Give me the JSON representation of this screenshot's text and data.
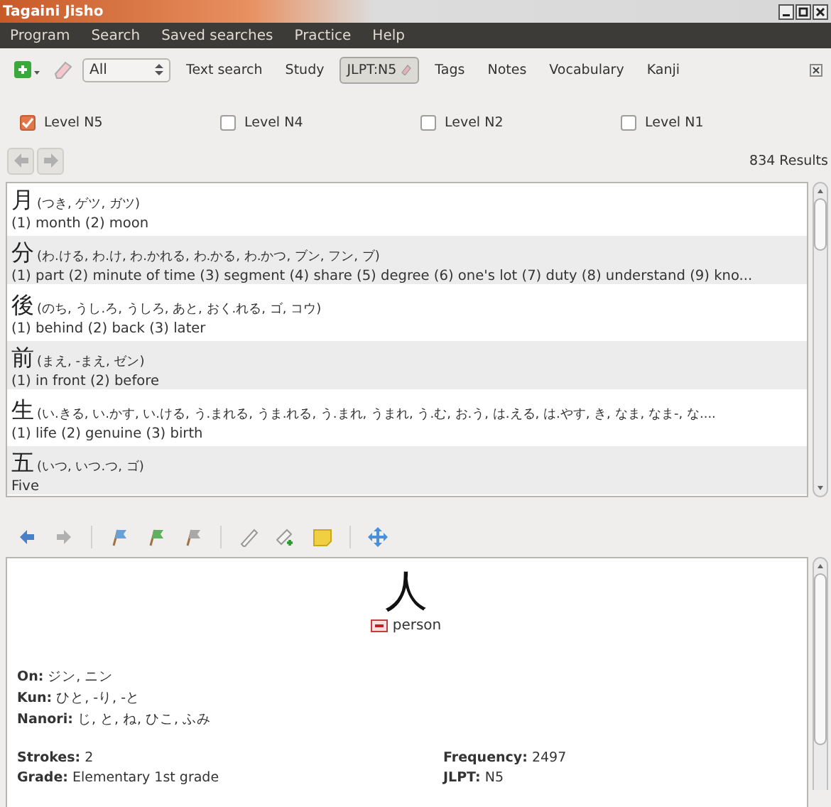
{
  "window": {
    "title": "Tagaini Jisho"
  },
  "menu": [
    "Program",
    "Search",
    "Saved searches",
    "Practice",
    "Help"
  ],
  "toolbar": {
    "filter": "All",
    "tabs": [
      {
        "label": "Text search",
        "selected": false,
        "removable": false
      },
      {
        "label": "Study",
        "selected": false,
        "removable": false
      },
      {
        "label": "JLPT:N5",
        "selected": true,
        "removable": true
      },
      {
        "label": "Tags",
        "selected": false,
        "removable": false
      },
      {
        "label": "Notes",
        "selected": false,
        "removable": false
      },
      {
        "label": "Vocabulary",
        "selected": false,
        "removable": false
      },
      {
        "label": "Kanji",
        "selected": false,
        "removable": false
      }
    ]
  },
  "levels": [
    {
      "label": "Level N5",
      "checked": true
    },
    {
      "label": "Level N4",
      "checked": false
    },
    {
      "label": "Level N2",
      "checked": false
    },
    {
      "label": "Level N1",
      "checked": false
    }
  ],
  "results": "834 Results",
  "entries": [
    {
      "kanji": "月",
      "readings": "(つき, ゲツ, ガツ)",
      "meaning": "(1) month (2) moon"
    },
    {
      "kanji": "分",
      "readings": "(わ.ける, わ.け, わ.かれる, わ.かる, わ.かつ, ブン, フン, ブ)",
      "meaning": "(1) part (2) minute of time (3) segment (4) share (5) degree (6) one's lot (7) duty (8) understand (9) kno..."
    },
    {
      "kanji": "後",
      "readings": "(のち, うし.ろ, うしろ, あと, おく.れる, ゴ, コウ)",
      "meaning": "(1) behind (2) back (3) later"
    },
    {
      "kanji": "前",
      "readings": "(まえ, -まえ, ゼン)",
      "meaning": "(1) in front (2) before"
    },
    {
      "kanji": "生",
      "readings": "(い.きる, い.かす, い.ける, う.まれる, うま.れる, う.まれ, うまれ, う.む, お.う, は.える, は.やす, き, なま, なま-, な....",
      "meaning": "(1) life (2) genuine (3) birth"
    },
    {
      "kanji": "五",
      "readings": "(いつ, いつ.つ, ゴ)",
      "meaning": "Five"
    }
  ],
  "detail": {
    "kanji": "人",
    "meaning": "person",
    "readings": [
      {
        "label": "On:",
        "value": "ジン, ニン"
      },
      {
        "label": "Kun:",
        "value": "ひと, -り, -と"
      },
      {
        "label": "Nanori:",
        "value": "じ, と, ね, ひこ, ふみ"
      }
    ],
    "stats": [
      {
        "label": "Strokes:",
        "value": "2"
      },
      {
        "label": "Frequency:",
        "value": "2497"
      },
      {
        "label": "Grade:",
        "value": "Elementary 1st grade"
      },
      {
        "label": "JLPT:",
        "value": "N5"
      }
    ]
  }
}
